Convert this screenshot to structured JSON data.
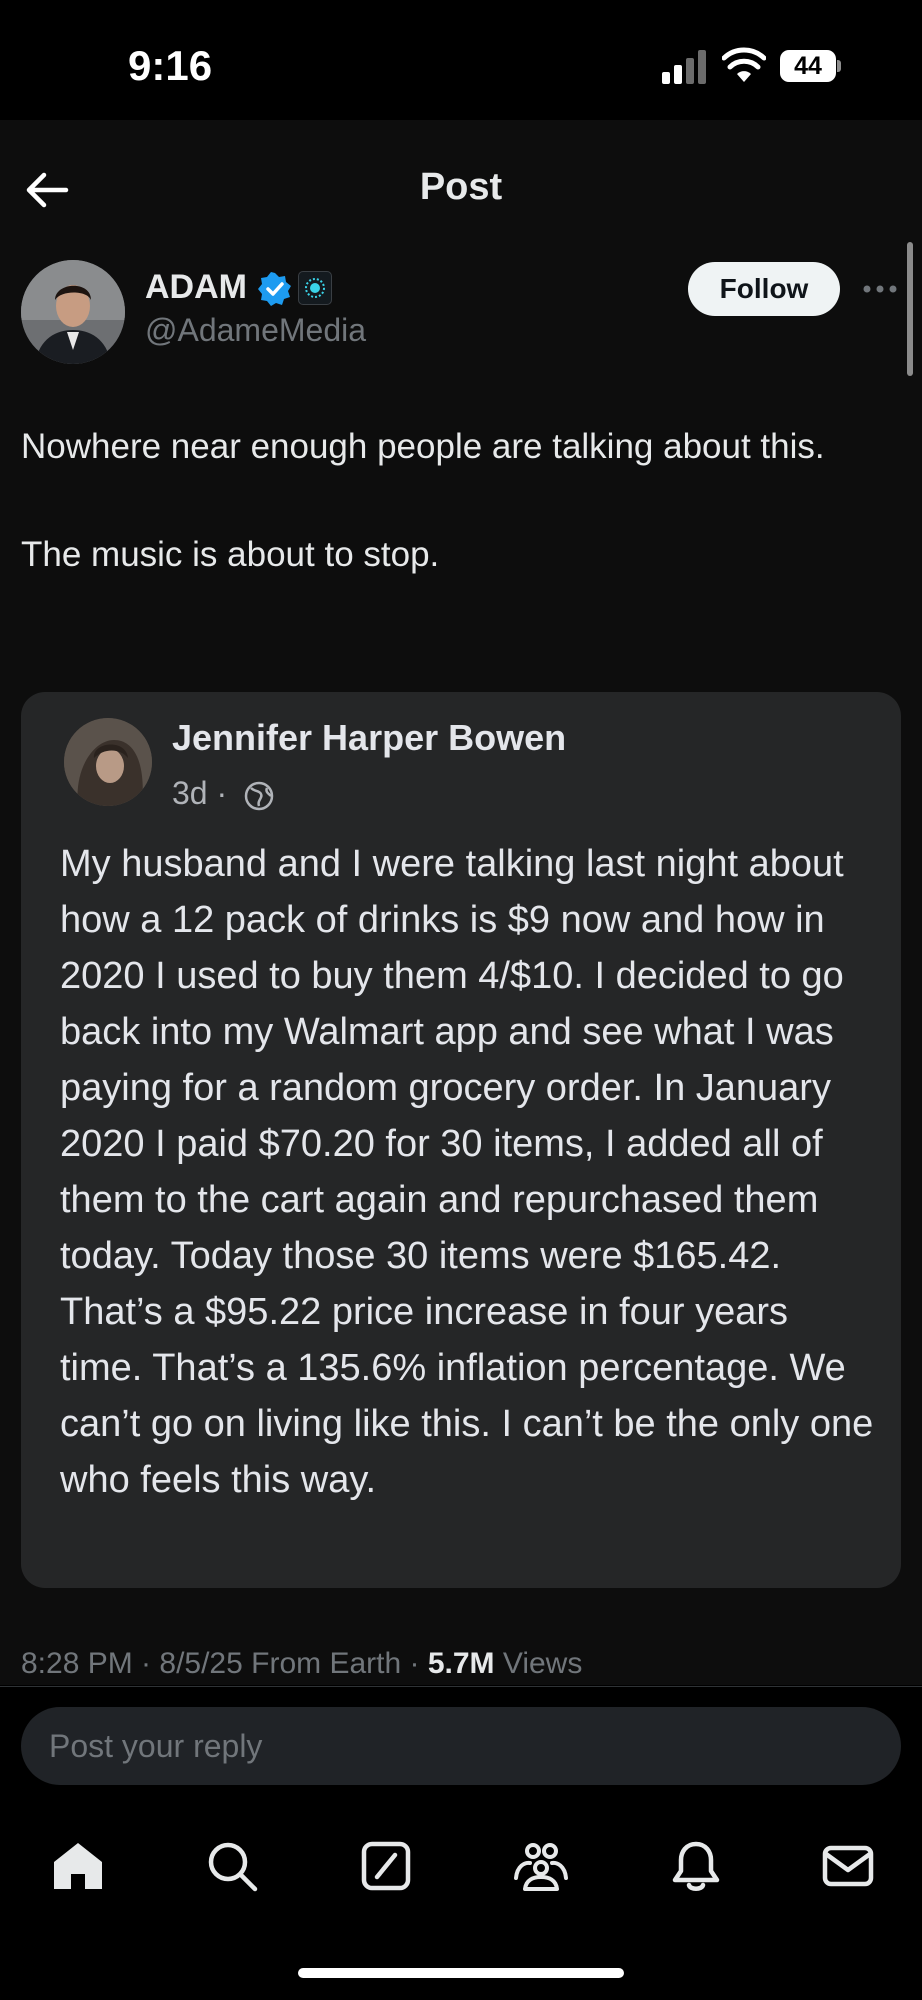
{
  "status_bar": {
    "time": "9:16",
    "battery": "44"
  },
  "header": {
    "title": "Post"
  },
  "post": {
    "author_name": "ADAM",
    "author_handle": "@AdameMedia",
    "follow_label": "Follow",
    "text": "Nowhere near enough people are talking about this.\n\nThe music is about to stop.",
    "embedded": {
      "name": "Jennifer Harper Bowen",
      "time": "3d ·",
      "body": "My husband and I were talking last night about how a 12 pack of drinks is $9 now and how in 2020 I used to buy them 4/$10. I decided to go back into my Walmart app and see what I was paying for a random grocery order. In January 2020 I paid $70.20 for 30 items, I added all of them to the cart again and repurchased them today. Today those 30 items were $165.42. That’s a $95.22 price increase in four years time. That’s a 135.6% inflation percentage. We can’t go on living like this. I can’t be the only one who feels this way."
    },
    "meta": {
      "timestamp": "8:28 PM · 8/5/25 From Earth · ",
      "views_count": "5.7M",
      "views_label": " Views"
    }
  },
  "reply": {
    "placeholder": "Post your reply"
  },
  "nav": [
    {
      "icon": "home-icon"
    },
    {
      "icon": "search-icon"
    },
    {
      "icon": "grok-icon"
    },
    {
      "icon": "communities-icon"
    },
    {
      "icon": "notifications-icon"
    },
    {
      "icon": "messages-icon"
    }
  ],
  "colors": {
    "verified": "#1d9bf0",
    "background": "#000000",
    "surface": "#0d0d0d",
    "card": "#252627"
  }
}
